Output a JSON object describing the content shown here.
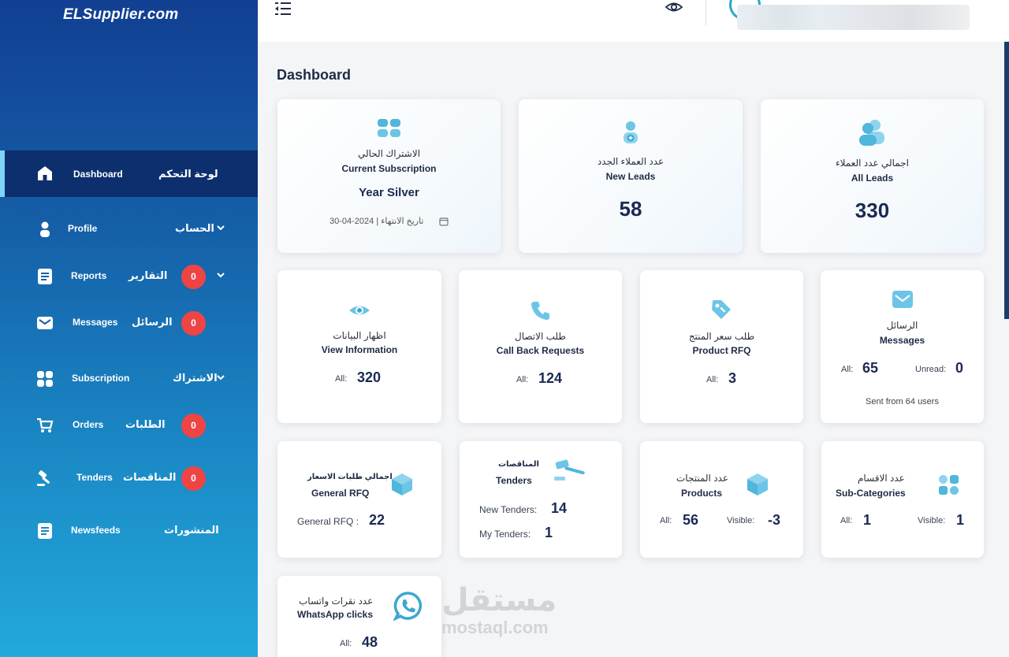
{
  "brand": {
    "logo": "ELSupplier.com"
  },
  "sidebar": {
    "items": [
      {
        "en": "Dashboard",
        "ar": "لوحة التحكم",
        "icon": "home-icon",
        "active": true
      },
      {
        "en": "Profile",
        "ar": "الحساب",
        "icon": "user-icon",
        "has_children": true
      },
      {
        "en": "Reports",
        "ar": "التقارير",
        "icon": "document-icon",
        "badge": "0",
        "has_children": true
      },
      {
        "en": "Messages",
        "ar": "الرسائل",
        "icon": "envelope-icon",
        "badge": "0"
      },
      {
        "en": "Subscription",
        "ar": "الاشتراك",
        "icon": "subscription-icon",
        "has_children": true
      },
      {
        "en": "Orders",
        "ar": "الطلبات",
        "icon": "cart-icon",
        "badge": "0"
      },
      {
        "en": "Tenders",
        "ar": "المناقصات",
        "icon": "gavel-icon",
        "badge": "0"
      },
      {
        "en": "Newsfeeds",
        "ar": "المنشورات",
        "icon": "document-icon"
      }
    ]
  },
  "topbar": {
    "menu_icon": "menu-collapse-icon",
    "eye_icon": "eye-icon"
  },
  "page": {
    "title": "Dashboard"
  },
  "cards": {
    "subscription": {
      "ar": "الاشتراك الحالي",
      "en": "Current Subscription",
      "plan": "Year Silver",
      "expiry": "30-04-2024 | تاريخ الانتهاء"
    },
    "new_leads": {
      "ar": "عدد العملاء الجدد",
      "en": "New Leads",
      "value": "58"
    },
    "all_leads": {
      "ar": "اجمالي عدد العملاء",
      "en": "All Leads",
      "value": "330"
    },
    "view_info": {
      "ar": "اظهار البيانات",
      "en": "View Information",
      "all_label": "All:",
      "value": "320"
    },
    "call_back": {
      "ar": "طلب الاتصال",
      "en": "Call Back Requests",
      "all_label": "All:",
      "value": "124"
    },
    "product_rfq": {
      "ar": "طلب سعر المنتج",
      "en": "Product RFQ",
      "all_label": "All:",
      "value": "3"
    },
    "messages": {
      "ar": "الرسائل",
      "en": "Messages",
      "all_label": "All:",
      "all_value": "65",
      "unread_label": "Unread:",
      "unread_value": "0",
      "note": "Sent from 64 users"
    },
    "general_rfq": {
      "ar": "اجمالي طلبات الاسعار",
      "en": "General RFQ",
      "label": "General RFQ :",
      "value": "22"
    },
    "tenders": {
      "ar": "المناقصات",
      "en": "Tenders",
      "new_label": "New Tenders:",
      "new_value": "14",
      "my_label": "My Tenders:",
      "my_value": "1"
    },
    "products": {
      "ar": "عدد المنتجات",
      "en": "Products",
      "all_label": "All:",
      "all_value": "56",
      "visible_label": "Visible:",
      "visible_value": "-3"
    },
    "subcategories": {
      "ar": "عدد الاقسام",
      "en": "Sub-Categories",
      "all_label": "All:",
      "all_value": "1",
      "visible_label": "Visible:",
      "visible_value": "1"
    },
    "whatsapp": {
      "ar": "عدد نقرات واتساب",
      "en": "WhatsApp clicks",
      "all_label": "All:",
      "value": "48"
    }
  },
  "watermark": {
    "ar": "مستقل",
    "en": "mostaql.com"
  },
  "colors": {
    "sidebar_top": "#123f92",
    "sidebar_bottom": "#23a9dc",
    "active_item": "#0d2f6e",
    "badge": "#ef4444",
    "icon_accent": "#4fb6dc",
    "text_dark": "#1a2a52"
  }
}
